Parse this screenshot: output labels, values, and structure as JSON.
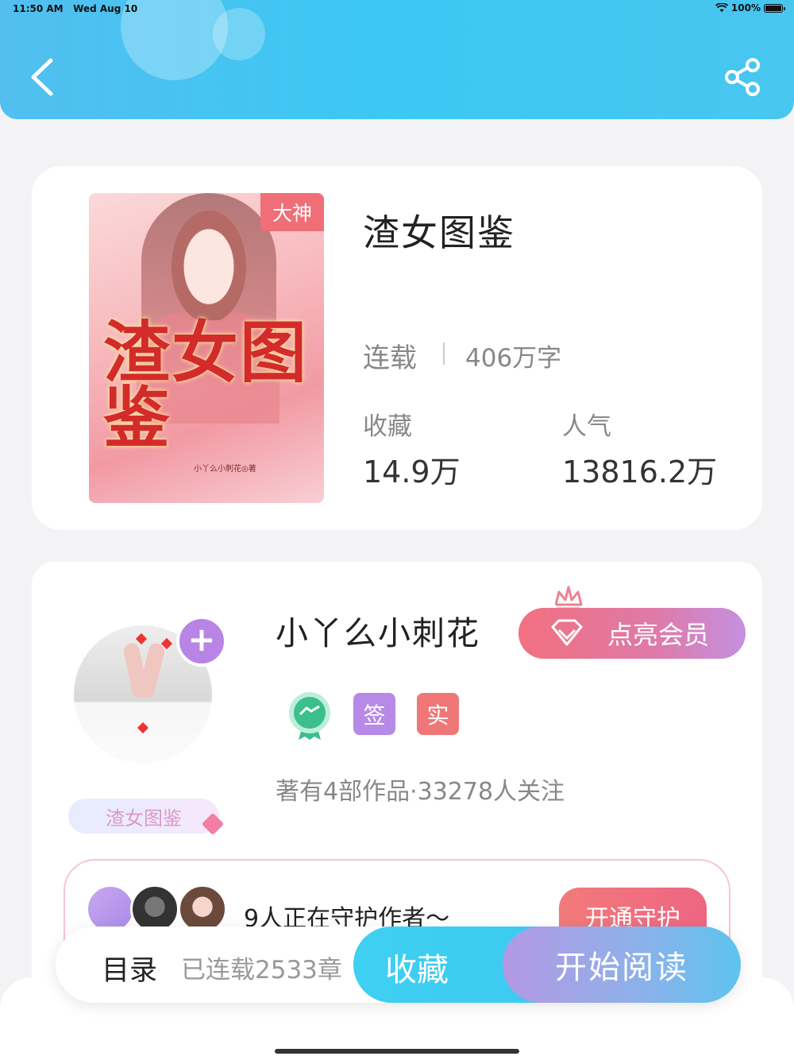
{
  "status_bar": {
    "time": "11:50 AM",
    "date": "Wed Aug 10",
    "battery": "100%"
  },
  "book": {
    "badge": "大神",
    "title": "渣女图鉴",
    "cover_title": "渣女图鉴",
    "cover_author": "小丫么小刺花◎著",
    "status": "连载",
    "word_count": "406万字",
    "favorites_label": "收藏",
    "favorites_value": "14.9万",
    "popularity_label": "人气",
    "popularity_value": "13816.2万"
  },
  "author": {
    "name": "小丫么小刺花",
    "fan_tag": "渣女图鉴",
    "member_button": "点亮会员",
    "tag_sign": "签",
    "tag_real": "实",
    "stats": "著有4部作品·33278人关注"
  },
  "guard": {
    "text": "9人正在守护作者～",
    "button": "开通守护"
  },
  "bottom_bar": {
    "toc_label": "目录",
    "chapters": "已连载2533章",
    "favorite_button": "收藏",
    "read_button": "开始阅读"
  },
  "colors": {
    "header": "#48c6f0",
    "badge": "#ef6e77",
    "member": "#de7aa9",
    "sign_tag": "#b68ae6",
    "real_tag": "#f07777",
    "favorite_btn": "#3fd0f2"
  },
  "icons": [
    "back-chevron-icon",
    "share-icon",
    "plus-icon",
    "crown-icon",
    "diamond-icon",
    "medal-icon",
    "wifi-icon",
    "battery-icon"
  ]
}
